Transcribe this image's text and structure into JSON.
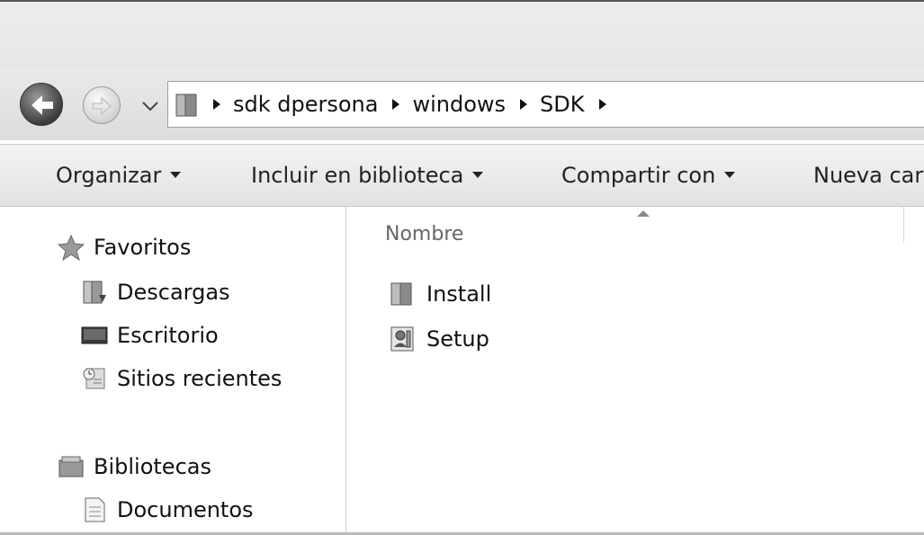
{
  "address": {
    "breadcrumbs": [
      "sdk dpersona",
      "windows",
      "SDK"
    ]
  },
  "toolbar": {
    "organize_label": "Organizar",
    "include_label": "Incluir en biblioteca",
    "share_label": "Compartir con",
    "new_folder_label": "Nueva car"
  },
  "navpane": {
    "favorites_label": "Favoritos",
    "favorites_items": [
      {
        "label": "Descargas",
        "icon": "downloads-folder-icon"
      },
      {
        "label": "Escritorio",
        "icon": "desktop-icon"
      },
      {
        "label": "Sitios recientes",
        "icon": "recent-places-icon"
      }
    ],
    "libraries_label": "Bibliotecas",
    "libraries_items": [
      {
        "label": "Documentos",
        "icon": "documents-icon"
      }
    ]
  },
  "content": {
    "column_name": "Nombre",
    "files": [
      {
        "name": "Install",
        "icon": "folder-icon"
      },
      {
        "name": "Setup",
        "icon": "setup-program-icon"
      }
    ]
  }
}
